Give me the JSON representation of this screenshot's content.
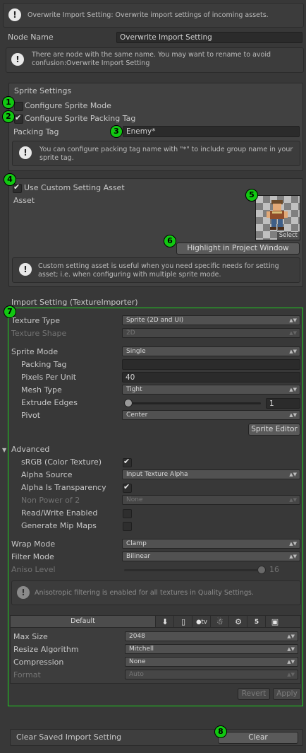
{
  "header": {
    "description": "Overwrite Import Setting: Overwrite import settings of incoming assets."
  },
  "node_name": {
    "label": "Node Name",
    "value": "Overwrite Import Setting"
  },
  "name_warning": "There are node with the same name. You may want to rename to avoid confusion:Overwrite Import Setting",
  "sprite_settings": {
    "title": "Sprite Settings",
    "configure_sprite_mode": "Configure Sprite Mode",
    "configure_packing_tag": "Configure Sprite Packing Tag",
    "packing_tag_label": "Packing Tag",
    "packing_tag_value": "Enemy*",
    "help": "You can configure packing tag name with \"*\" to include group name in your sprite tag."
  },
  "custom_asset": {
    "use_label": "Use Custom Setting Asset",
    "asset_label": "Asset",
    "select_label": "Select",
    "highlight_button": "Highlight in Project Window",
    "help": "Custom setting asset is useful when you need specific needs for setting asset; i.e. when configuring with multiple sprite mode."
  },
  "import_setting": {
    "title": "Import Setting (TextureImporter)",
    "texture_type": {
      "label": "Texture Type",
      "value": "Sprite (2D and UI)"
    },
    "texture_shape": {
      "label": "Texture Shape",
      "value": "2D"
    },
    "sprite_mode": {
      "label": "Sprite Mode",
      "value": "Single"
    },
    "packing_tag": {
      "label": "Packing Tag",
      "value": ""
    },
    "ppu": {
      "label": "Pixels Per Unit",
      "value": "40"
    },
    "mesh_type": {
      "label": "Mesh Type",
      "value": "Tight"
    },
    "extrude": {
      "label": "Extrude Edges",
      "value": "1"
    },
    "pivot": {
      "label": "Pivot",
      "value": "Center"
    },
    "sprite_editor": "Sprite Editor",
    "advanced": "Advanced",
    "srgb": {
      "label": "sRGB (Color Texture)",
      "checked": true
    },
    "alpha_source": {
      "label": "Alpha Source",
      "value": "Input Texture Alpha"
    },
    "alpha_transparency": {
      "label": "Alpha Is Transparency",
      "checked": true
    },
    "non_power": {
      "label": "Non Power of 2",
      "value": "None"
    },
    "read_write": {
      "label": "Read/Write Enabled",
      "checked": false
    },
    "mipmaps": {
      "label": "Generate Mip Maps",
      "checked": false
    },
    "wrap_mode": {
      "label": "Wrap Mode",
      "value": "Clamp"
    },
    "filter_mode": {
      "label": "Filter Mode",
      "value": "Bilinear"
    },
    "aniso": {
      "label": "Aniso Level",
      "value": "16"
    },
    "aniso_help": "Anisotropic filtering is enabled for all textures in Quality Settings.",
    "platform_default": "Default",
    "platform_icons": [
      "download-icon",
      "phone-icon",
      "apple-tv-icon",
      "android-icon",
      "unity-icon",
      "html5-icon",
      "box-icon"
    ],
    "tv_label": "tv",
    "max_size": {
      "label": "Max Size",
      "value": "2048"
    },
    "resize": {
      "label": "Resize Algorithm",
      "value": "Mitchell"
    },
    "compression": {
      "label": "Compression",
      "value": "None"
    },
    "format": {
      "label": "Format",
      "value": "Auto"
    },
    "revert": "Revert",
    "apply": "Apply"
  },
  "clear_saved": {
    "label": "Clear Saved Import Setting",
    "button": "Clear"
  },
  "markers": [
    "1",
    "2",
    "3",
    "4",
    "5",
    "6",
    "7",
    "8"
  ],
  "colors": {
    "marker": "#11c811",
    "outline": "#1fd11f",
    "background": "#383838"
  }
}
